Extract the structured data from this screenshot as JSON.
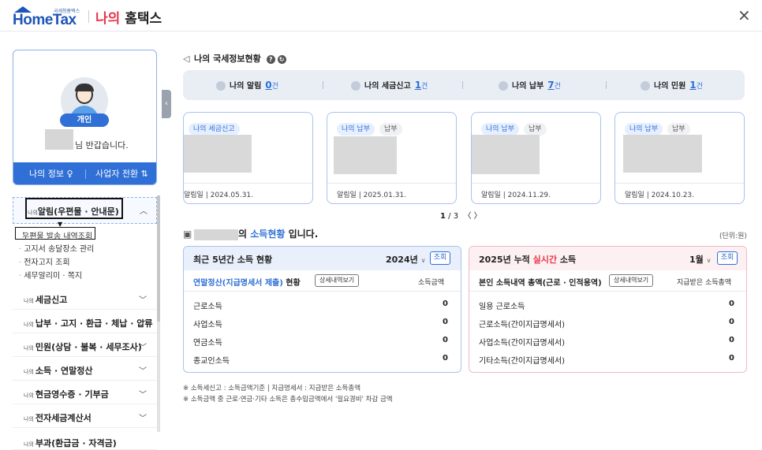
{
  "header": {
    "logo_small": "국세청홈택스",
    "logo_text": "HomeTax",
    "title_red": "나의",
    "title_rest": " 홈택스",
    "close_symbol": "×"
  },
  "profile": {
    "badge": "개인",
    "greeting": "님 반갑습니다.",
    "my_info_label": "나의 정보",
    "switch_label": "사업자 전환"
  },
  "menu": {
    "open": {
      "prefix": "나의",
      "label": "알림(우편물 · 안내문)"
    },
    "sub_items": [
      "우편물 발송 내역조회",
      "고지서 송달장소 관리",
      "전자고지 조회",
      "세무알리미 · 쪽지"
    ],
    "items": [
      {
        "prefix": "나의",
        "label": "세금신고"
      },
      {
        "prefix": "나의",
        "label": "납부 · 고지 · 환급 · 체납 · 압류"
      },
      {
        "prefix": "나의",
        "label": "민원(상담 · 불복 · 세무조사)"
      },
      {
        "prefix": "나의",
        "label": "소득 · 연말정산"
      },
      {
        "prefix": "나의",
        "label": "현금영수증 · 기부금"
      },
      {
        "prefix": "나의",
        "label": "전자세금계산서"
      },
      {
        "prefix": "나의",
        "label": "부과(환급금 · 자격금)"
      }
    ]
  },
  "status": {
    "title": "나의 국세정보현황",
    "items": [
      {
        "label": "나의 알림",
        "count": "0",
        "unit": "건"
      },
      {
        "label": "나의 세금신고",
        "count": "1",
        "unit": "건"
      },
      {
        "label": "나의 납부",
        "count": "7",
        "unit": "건"
      },
      {
        "label": "나의 민원",
        "count": "1",
        "unit": "건"
      }
    ]
  },
  "cards": [
    {
      "tags": [
        "나의 세금신고"
      ],
      "date_label": "알림일",
      "date": "2024.05.31."
    },
    {
      "tags": [
        "나의 납부",
        "납부"
      ],
      "date_label": "알림일",
      "date": "2025.01.31."
    },
    {
      "tags": [
        "나의 납부",
        "납부"
      ],
      "date_label": "알림일",
      "date": "2024.11.29."
    },
    {
      "tags": [
        "나의 납부",
        "납부"
      ],
      "date_label": "알림일",
      "date": "2024.10.23."
    }
  ],
  "pager": {
    "current": "1",
    "total": "/ 3",
    "prev": "〈",
    "next": "〉"
  },
  "income": {
    "title_suffix": "의",
    "title_link": "소득현황",
    "title_end": " 입니다.",
    "unit": "(단위:원)",
    "left": {
      "title": "최근 5년간 소득 현황",
      "year": "2024년",
      "query_label": "조회",
      "sub_title_link": "연말정산(지급명세서 제출)",
      "sub_title_rest": " 현황",
      "detail_btn": "상세내역보기",
      "col_label": "소득금액",
      "rows": [
        {
          "label": "근로소득",
          "value": "0"
        },
        {
          "label": "사업소득",
          "value": "0"
        },
        {
          "label": "연금소득",
          "value": "0"
        },
        {
          "label": "종교인소득",
          "value": "0"
        }
      ]
    },
    "right": {
      "title_a": "2025년 누적 ",
      "title_red": "실시간",
      "title_b": " 소득",
      "month": "1월",
      "query_label": "조회",
      "sub_title": "본인 소득내역 총액(근로 · 인적용역)",
      "detail_btn": "상세내역보기",
      "col_label": "지급받은 소득총액",
      "rows": [
        {
          "label": "일용 근로소득",
          "value": "0"
        },
        {
          "label": "근로소득(간이지급명세서)",
          "value": "0"
        },
        {
          "label": "사업소득(간이지급명세서)",
          "value": "0"
        },
        {
          "label": "기타소득(간이지급명세서)",
          "value": "0"
        }
      ]
    }
  },
  "notes": [
    "※ 소득세신고 : 소득금액기준  |  지급명세서 : 지급받은 소득총액",
    "※ 소득금액 중 근로·연금·기타 소득은 총수입금액에서 '필요경비' 차감 금액"
  ]
}
